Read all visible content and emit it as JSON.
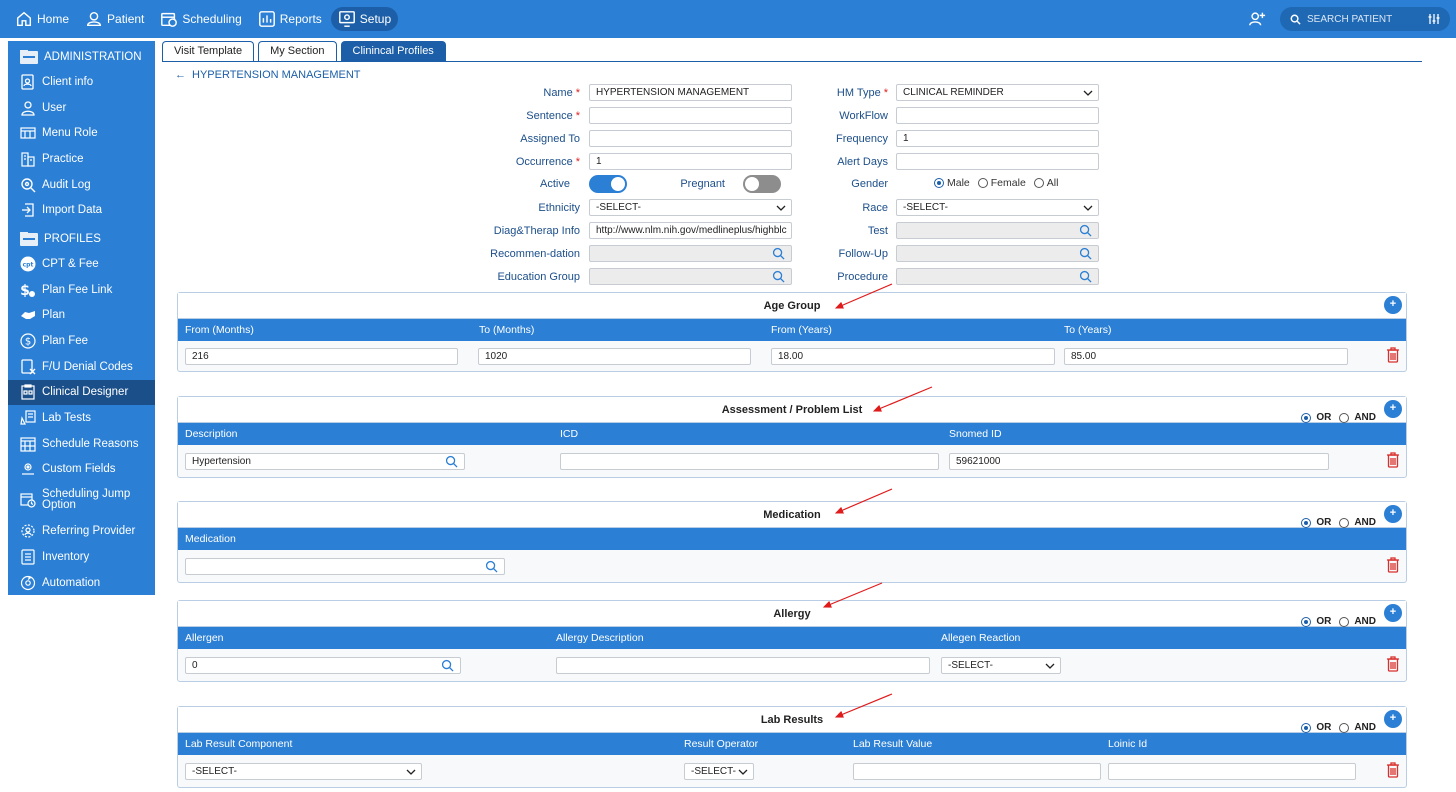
{
  "topnav": [
    {
      "label": "Home",
      "icon": "home-icon"
    },
    {
      "label": "Patient",
      "icon": "person-icon"
    },
    {
      "label": "Scheduling",
      "icon": "calendar-icon"
    },
    {
      "label": "Reports",
      "icon": "bar-chart-icon"
    },
    {
      "label": "Setup",
      "icon": "monitor-gear-icon"
    }
  ],
  "search": {
    "placeholder": "SEARCH PATIENT"
  },
  "sidebar": {
    "admin_title": "ADMINISTRATION",
    "profiles_title": "PROFILES",
    "admin_items": [
      "Client info",
      "User",
      "Menu Role",
      "Practice",
      "Audit Log",
      "Import Data"
    ],
    "profile_items": [
      "CPT & Fee",
      "Plan Fee Link",
      "Plan",
      "Plan Fee",
      "F/U Denial Codes",
      "Clinical Designer",
      "Lab Tests",
      "Schedule Reasons",
      "Custom Fields",
      "Scheduling Jump Option",
      "Referring Provider",
      "Inventory",
      "Automation"
    ]
  },
  "tabs": [
    "Visit Template",
    "My Section",
    "Clinincal Profiles"
  ],
  "back_label": "HYPERTENSION MANAGEMENT",
  "form": {
    "name_label": "Name",
    "name_value": "HYPERTENSION MANAGEMENT",
    "hm_type_label": "HM Type",
    "hm_type_value": "CLINICAL REMINDER",
    "sentence_label": "Sentence",
    "workflow_label": "WorkFlow",
    "assigned_label": "Assigned To",
    "frequency_label": "Frequency",
    "frequency_value": "1",
    "occurrence_label": "Occurrence",
    "occurrence_value": "1",
    "alert_label": "Alert Days",
    "active_label": "Active",
    "pregnant_label": "Pregnant",
    "gender_label": "Gender",
    "gender_options": [
      "Male",
      "Female",
      "All"
    ],
    "ethnicity_label": "Ethnicity",
    "ethnicity_value": "-SELECT-",
    "race_label": "Race",
    "race_value": "-SELECT-",
    "diag_label": "Diag&Therap Info",
    "diag_value": "http://www.nlm.nih.gov/medlineplus/highblc",
    "test_label": "Test",
    "recommend_label": "Recommen-dation",
    "followup_label": "Follow-Up",
    "education_label": "Education Group",
    "procedure_label": "Procedure"
  },
  "age_group": {
    "title": "Age Group",
    "headers": [
      "From (Months)",
      "To (Months)",
      "From (Years)",
      "To (Years)"
    ],
    "values": [
      "216",
      "1020",
      "18.00",
      "85.00"
    ]
  },
  "assessment": {
    "title": "Assessment / Problem List",
    "headers": [
      "Description",
      "ICD",
      "Snomed ID"
    ],
    "values": [
      "Hypertension",
      "",
      "59621000"
    ]
  },
  "medication": {
    "title": "Medication",
    "headers": [
      "Medication"
    ]
  },
  "allergy": {
    "title": "Allergy",
    "headers": [
      "Allergen",
      "Allergy Description",
      "Allegen Reaction"
    ],
    "values": [
      "0",
      "",
      "-SELECT-"
    ]
  },
  "lab_results": {
    "title": "Lab Results",
    "headers": [
      "Lab Result Component",
      "Result Operator",
      "Lab Result Value",
      "Loinic Id"
    ],
    "values": [
      "-SELECT-",
      "-SELECT-",
      "",
      ""
    ]
  },
  "or_label": "OR",
  "and_label": "AND"
}
